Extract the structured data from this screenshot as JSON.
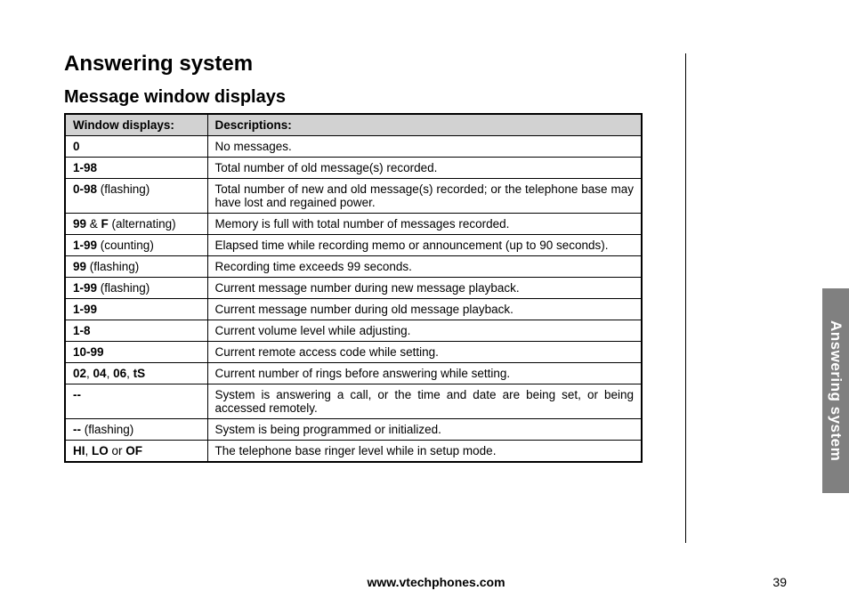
{
  "title": "Answering system",
  "subtitle": "Message window displays",
  "side_tab": "Answering system",
  "footer": {
    "url": "www.vtechphones.com",
    "page": "39"
  },
  "headers": {
    "col1": "Window displays:",
    "col2": "Descriptions:"
  },
  "rows": [
    {
      "code_bold": "0",
      "code_tail": "",
      "desc": "No messages."
    },
    {
      "code_bold": "1-98",
      "code_tail": "",
      "desc": "Total number of old message(s) recorded."
    },
    {
      "code_bold": "0-98",
      "code_tail": " (flashing)",
      "desc": "Total number of new and old message(s) recorded; or the telephone base may have lost and regained power.",
      "justify": true
    },
    {
      "code_html": "<span class=\"b\">99</span><span class=\"n\"> &amp; </span><span class=\"b\">F</span><span class=\"n\"> (alternating)</span>",
      "desc": "Memory is full with total number of messages recorded."
    },
    {
      "code_bold": "1-99",
      "code_tail": " (counting)",
      "desc": "Elapsed time while recording memo or announcement (up to 90 seconds).",
      "justify": true
    },
    {
      "code_bold": "99",
      "code_tail": " (flashing)",
      "desc": "Recording time exceeds 99 seconds."
    },
    {
      "code_bold": "1-99",
      "code_tail": " (flashing)",
      "desc": "Current message number during new message playback."
    },
    {
      "code_bold": "1-99",
      "code_tail": "",
      "desc": "Current message number during old message playback."
    },
    {
      "code_bold": "1-8",
      "code_tail": "",
      "desc": "Current volume level while adjusting."
    },
    {
      "code_bold": "10-99",
      "code_tail": "",
      "desc": "Current remote access code while setting."
    },
    {
      "code_html": "<span class=\"b\">02</span><span class=\"n\">, </span><span class=\"b\">04</span><span class=\"n\">, </span><span class=\"b\">06</span><span class=\"n\">, </span><span class=\"b\">tS</span>",
      "desc": "Current number of rings before answering while setting."
    },
    {
      "code_bold": "--",
      "code_tail": "",
      "desc": "System is answering a call, or the time and date are being set, or being accessed remotely.",
      "justify": true
    },
    {
      "code_bold": "--",
      "code_tail": " (flashing)",
      "desc": "System is being programmed or initialized."
    },
    {
      "code_html": "<span class=\"b\">HI</span><span class=\"n\">, </span><span class=\"b\">LO</span><span class=\"n\"> or </span><span class=\"b\">OF</span>",
      "desc": "The telephone base ringer level while in setup mode."
    }
  ]
}
